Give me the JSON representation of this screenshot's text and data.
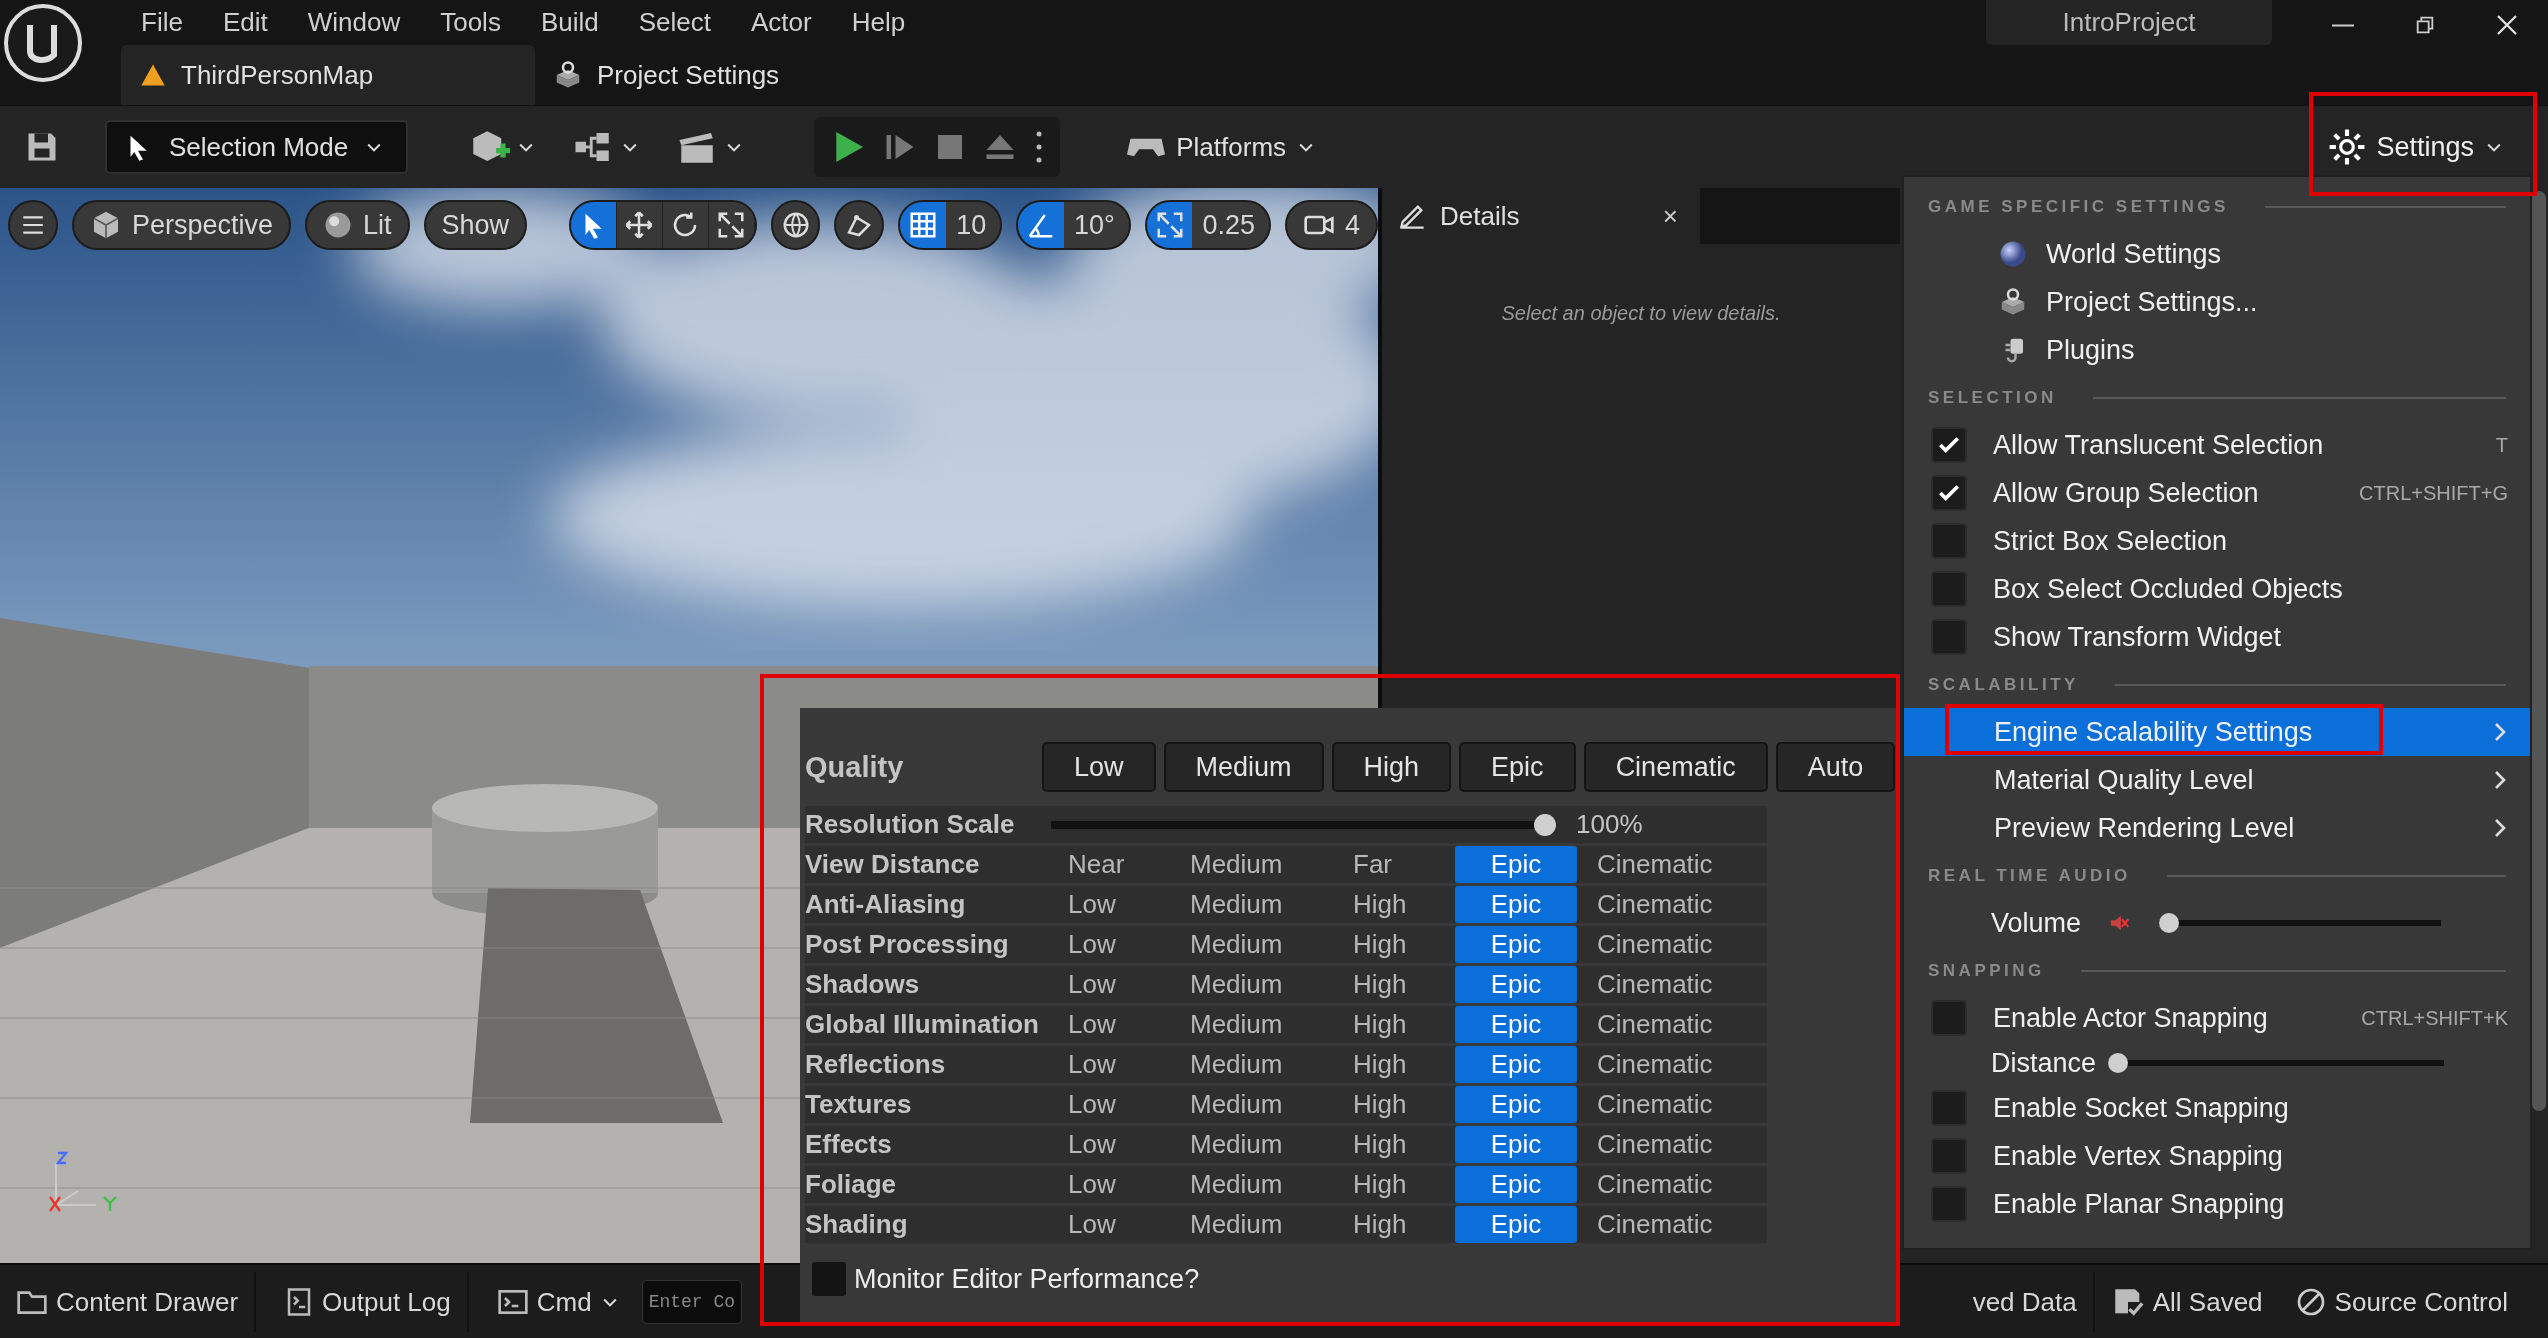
{
  "menu_bar": [
    "File",
    "Edit",
    "Window",
    "Tools",
    "Build",
    "Select",
    "Actor",
    "Help"
  ],
  "project_name": "IntroProject",
  "document_tabs": [
    {
      "label": "ThirdPersonMap",
      "selected": true
    },
    {
      "label": "Project Settings",
      "selected": false
    }
  ],
  "toolbar": {
    "selection_mode": "Selection Mode",
    "platforms": "Platforms",
    "settings": "Settings"
  },
  "viewport": {
    "view_mode": "Perspective",
    "lighting": "Lit",
    "show": "Show",
    "transform_tools": [
      {
        "kind": "select",
        "selected": true
      },
      {
        "kind": "move",
        "selected": false
      },
      {
        "kind": "rotate",
        "selected": false
      },
      {
        "kind": "scale",
        "selected": false
      }
    ],
    "snaps": [
      {
        "kind": "grid",
        "value": "10",
        "on": true
      },
      {
        "kind": "angle",
        "value": "10°",
        "on": true
      },
      {
        "kind": "scale",
        "value": "0.25",
        "on": true
      }
    ],
    "camera_speed": "4"
  },
  "details": {
    "title": "Details",
    "close": "×",
    "empty_message": "Select an object to view details."
  },
  "settings_menu": {
    "sections": [
      {
        "heading": "GAME SPECIFIC SETTINGS",
        "items": [
          {
            "kind": "command",
            "label": "World Settings"
          },
          {
            "kind": "command",
            "label": "Project Settings..."
          },
          {
            "kind": "command",
            "label": "Plugins"
          }
        ]
      },
      {
        "heading": "SELECTION",
        "items": [
          {
            "kind": "checkbox",
            "label": "Allow Translucent Selection",
            "checked": true,
            "shortcut": "T"
          },
          {
            "kind": "checkbox",
            "label": "Allow Group Selection",
            "checked": true,
            "shortcut": "CTRL+SHIFT+G"
          },
          {
            "kind": "checkbox",
            "label": "Strict Box Selection",
            "checked": false
          },
          {
            "kind": "checkbox",
            "label": "Box Select Occluded Objects",
            "checked": false
          },
          {
            "kind": "checkbox",
            "label": "Show Transform Widget",
            "checked": false
          }
        ]
      },
      {
        "heading": "SCALABILITY",
        "items": [
          {
            "kind": "submenu",
            "label": "Engine Scalability Settings",
            "selected": true
          },
          {
            "kind": "submenu",
            "label": "Material Quality Level",
            "selected": false
          },
          {
            "kind": "submenu",
            "label": "Preview Rendering Level",
            "selected": false
          }
        ]
      },
      {
        "heading": "REAL TIME AUDIO",
        "items": [
          {
            "kind": "slider",
            "label": "Volume",
            "muted": true,
            "level": 0
          }
        ]
      },
      {
        "heading": "SNAPPING",
        "items": [
          {
            "kind": "checkbox",
            "label": "Enable Actor Snapping",
            "checked": false,
            "shortcut": "CTRL+SHIFT+K"
          },
          {
            "kind": "slider",
            "label": "Distance",
            "muted": false,
            "level": 0
          },
          {
            "kind": "checkbox",
            "label": "Enable Socket Snapping",
            "checked": false
          },
          {
            "kind": "checkbox",
            "label": "Enable Vertex Snapping",
            "checked": false
          },
          {
            "kind": "checkbox",
            "label": "Enable Planar Snapping",
            "checked": false
          }
        ]
      }
    ]
  },
  "scalability": {
    "quality_label": "Quality",
    "presets": [
      "Low",
      "Medium",
      "High",
      "Epic",
      "Cinematic",
      "Auto"
    ],
    "resolution": {
      "label": "Resolution Scale",
      "level": 1,
      "reading": "100%"
    },
    "rows": [
      {
        "label": "View Distance",
        "options": [
          {
            "label": "Near",
            "selected": false
          },
          {
            "label": "Medium",
            "selected": false
          },
          {
            "label": "Far",
            "selected": false
          },
          {
            "label": "Epic",
            "selected": true
          },
          {
            "label": "Cinematic",
            "selected": false
          }
        ]
      },
      {
        "label": "Anti-Aliasing",
        "options": [
          {
            "label": "Low",
            "selected": false
          },
          {
            "label": "Medium",
            "selected": false
          },
          {
            "label": "High",
            "selected": false
          },
          {
            "label": "Epic",
            "selected": true
          },
          {
            "label": "Cinematic",
            "selected": false
          }
        ]
      },
      {
        "label": "Post Processing",
        "options": [
          {
            "label": "Low",
            "selected": false
          },
          {
            "label": "Medium",
            "selected": false
          },
          {
            "label": "High",
            "selected": false
          },
          {
            "label": "Epic",
            "selected": true
          },
          {
            "label": "Cinematic",
            "selected": false
          }
        ]
      },
      {
        "label": "Shadows",
        "options": [
          {
            "label": "Low",
            "selected": false
          },
          {
            "label": "Medium",
            "selected": false
          },
          {
            "label": "High",
            "selected": false
          },
          {
            "label": "Epic",
            "selected": true
          },
          {
            "label": "Cinematic",
            "selected": false
          }
        ]
      },
      {
        "label": "Global Illumination",
        "options": [
          {
            "label": "Low",
            "selected": false
          },
          {
            "label": "Medium",
            "selected": false
          },
          {
            "label": "High",
            "selected": false
          },
          {
            "label": "Epic",
            "selected": true
          },
          {
            "label": "Cinematic",
            "selected": false
          }
        ]
      },
      {
        "label": "Reflections",
        "options": [
          {
            "label": "Low",
            "selected": false
          },
          {
            "label": "Medium",
            "selected": false
          },
          {
            "label": "High",
            "selected": false
          },
          {
            "label": "Epic",
            "selected": true
          },
          {
            "label": "Cinematic",
            "selected": false
          }
        ]
      },
      {
        "label": "Textures",
        "options": [
          {
            "label": "Low",
            "selected": false
          },
          {
            "label": "Medium",
            "selected": false
          },
          {
            "label": "High",
            "selected": false
          },
          {
            "label": "Epic",
            "selected": true
          },
          {
            "label": "Cinematic",
            "selected": false
          }
        ]
      },
      {
        "label": "Effects",
        "options": [
          {
            "label": "Low",
            "selected": false
          },
          {
            "label": "Medium",
            "selected": false
          },
          {
            "label": "High",
            "selected": false
          },
          {
            "label": "Epic",
            "selected": true
          },
          {
            "label": "Cinematic",
            "selected": false
          }
        ]
      },
      {
        "label": "Foliage",
        "options": [
          {
            "label": "Low",
            "selected": false
          },
          {
            "label": "Medium",
            "selected": false
          },
          {
            "label": "High",
            "selected": false
          },
          {
            "label": "Epic",
            "selected": true
          },
          {
            "label": "Cinematic",
            "selected": false
          }
        ]
      },
      {
        "label": "Shading",
        "options": [
          {
            "label": "Low",
            "selected": false
          },
          {
            "label": "Medium",
            "selected": false
          },
          {
            "label": "High",
            "selected": false
          },
          {
            "label": "Epic",
            "selected": true
          },
          {
            "label": "Cinematic",
            "selected": false
          }
        ]
      }
    ],
    "monitor": {
      "label": "Monitor Editor Performance?",
      "checked": false
    }
  },
  "status_bar": {
    "content_drawer": "Content Drawer",
    "output_log": "Output Log",
    "cmd": "Cmd",
    "console_placeholder": "Enter Co",
    "unsaved": "ved Data",
    "saved": "All Saved",
    "source_control": "Source Control"
  }
}
